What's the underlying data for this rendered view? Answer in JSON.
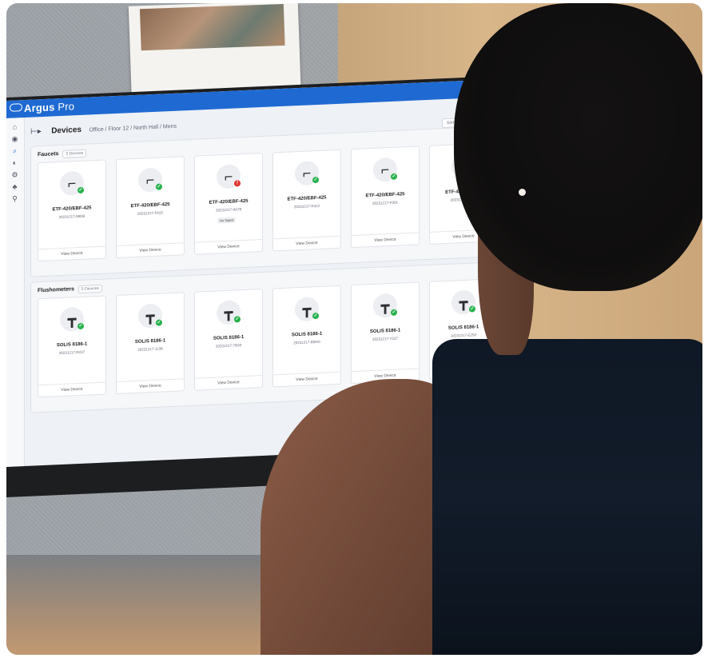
{
  "app": {
    "brand_name": "Argus",
    "brand_suffix": "Pro",
    "brand_color": "#1f6ad2"
  },
  "header": {
    "collapse_icon": "⊢▸",
    "title": "Devices",
    "breadcrumb": "Office / Floor 12 / North Hall / Mens",
    "sort_label": "Sort by"
  },
  "sidebar": {
    "icons": [
      "home-icon",
      "location-pin-icon",
      "devices-icon",
      "analytics-icon",
      "settings-icon",
      "users-icon",
      "search-icon"
    ]
  },
  "faucets": {
    "title": "Faucets",
    "count": "5 Devices",
    "cards": [
      {
        "model": "ETF-420/EBF-425",
        "serial": "20231217-69DB",
        "status": "ok",
        "view": "View Device"
      },
      {
        "model": "ETF-420/EBF-425",
        "serial": "20231217-FA32",
        "status": "ok",
        "view": "View Device"
      },
      {
        "model": "ETF-420/EBF-425",
        "serial": "20231217-9A78",
        "status": "err",
        "signal": "No Signal",
        "view": "View Device"
      },
      {
        "model": "ETF-420/EBF-425",
        "serial": "20231217-R412",
        "status": "ok",
        "view": "View Device"
      },
      {
        "model": "ETF-420/EBF-425",
        "serial": "20231217-P301",
        "status": "ok",
        "view": "View Device"
      },
      {
        "model": "ETF-420/EBF-42",
        "serial": "20231217-1B4C",
        "status": "ok",
        "view": "View Device"
      }
    ]
  },
  "flushometers": {
    "title": "Flushometers",
    "count": "5 Devices",
    "cards": [
      {
        "model": "SOLIS 8186-1",
        "serial": "20231217-R237",
        "status": "ok",
        "view": "View Device"
      },
      {
        "model": "SOLIS 8186-1",
        "serial": "20231217-1138",
        "status": "ok",
        "view": "View Device"
      },
      {
        "model": "SOLIS 8186-1",
        "serial": "20231217-75D0",
        "status": "ok",
        "view": "View Device"
      },
      {
        "model": "SOLIS 8186-1",
        "serial": "20231217-8SHD",
        "status": "ok",
        "view": "View Device"
      },
      {
        "model": "SOLIS 8186-1",
        "serial": "20231217-Y237",
        "status": "ok",
        "view": "View Device"
      },
      {
        "model": "SOLIS 8186-1",
        "serial": "20231217-E250",
        "status": "ok",
        "view": "View Device"
      }
    ]
  },
  "status_colors": {
    "ok": "#27b14c",
    "err": "#e0352f"
  }
}
